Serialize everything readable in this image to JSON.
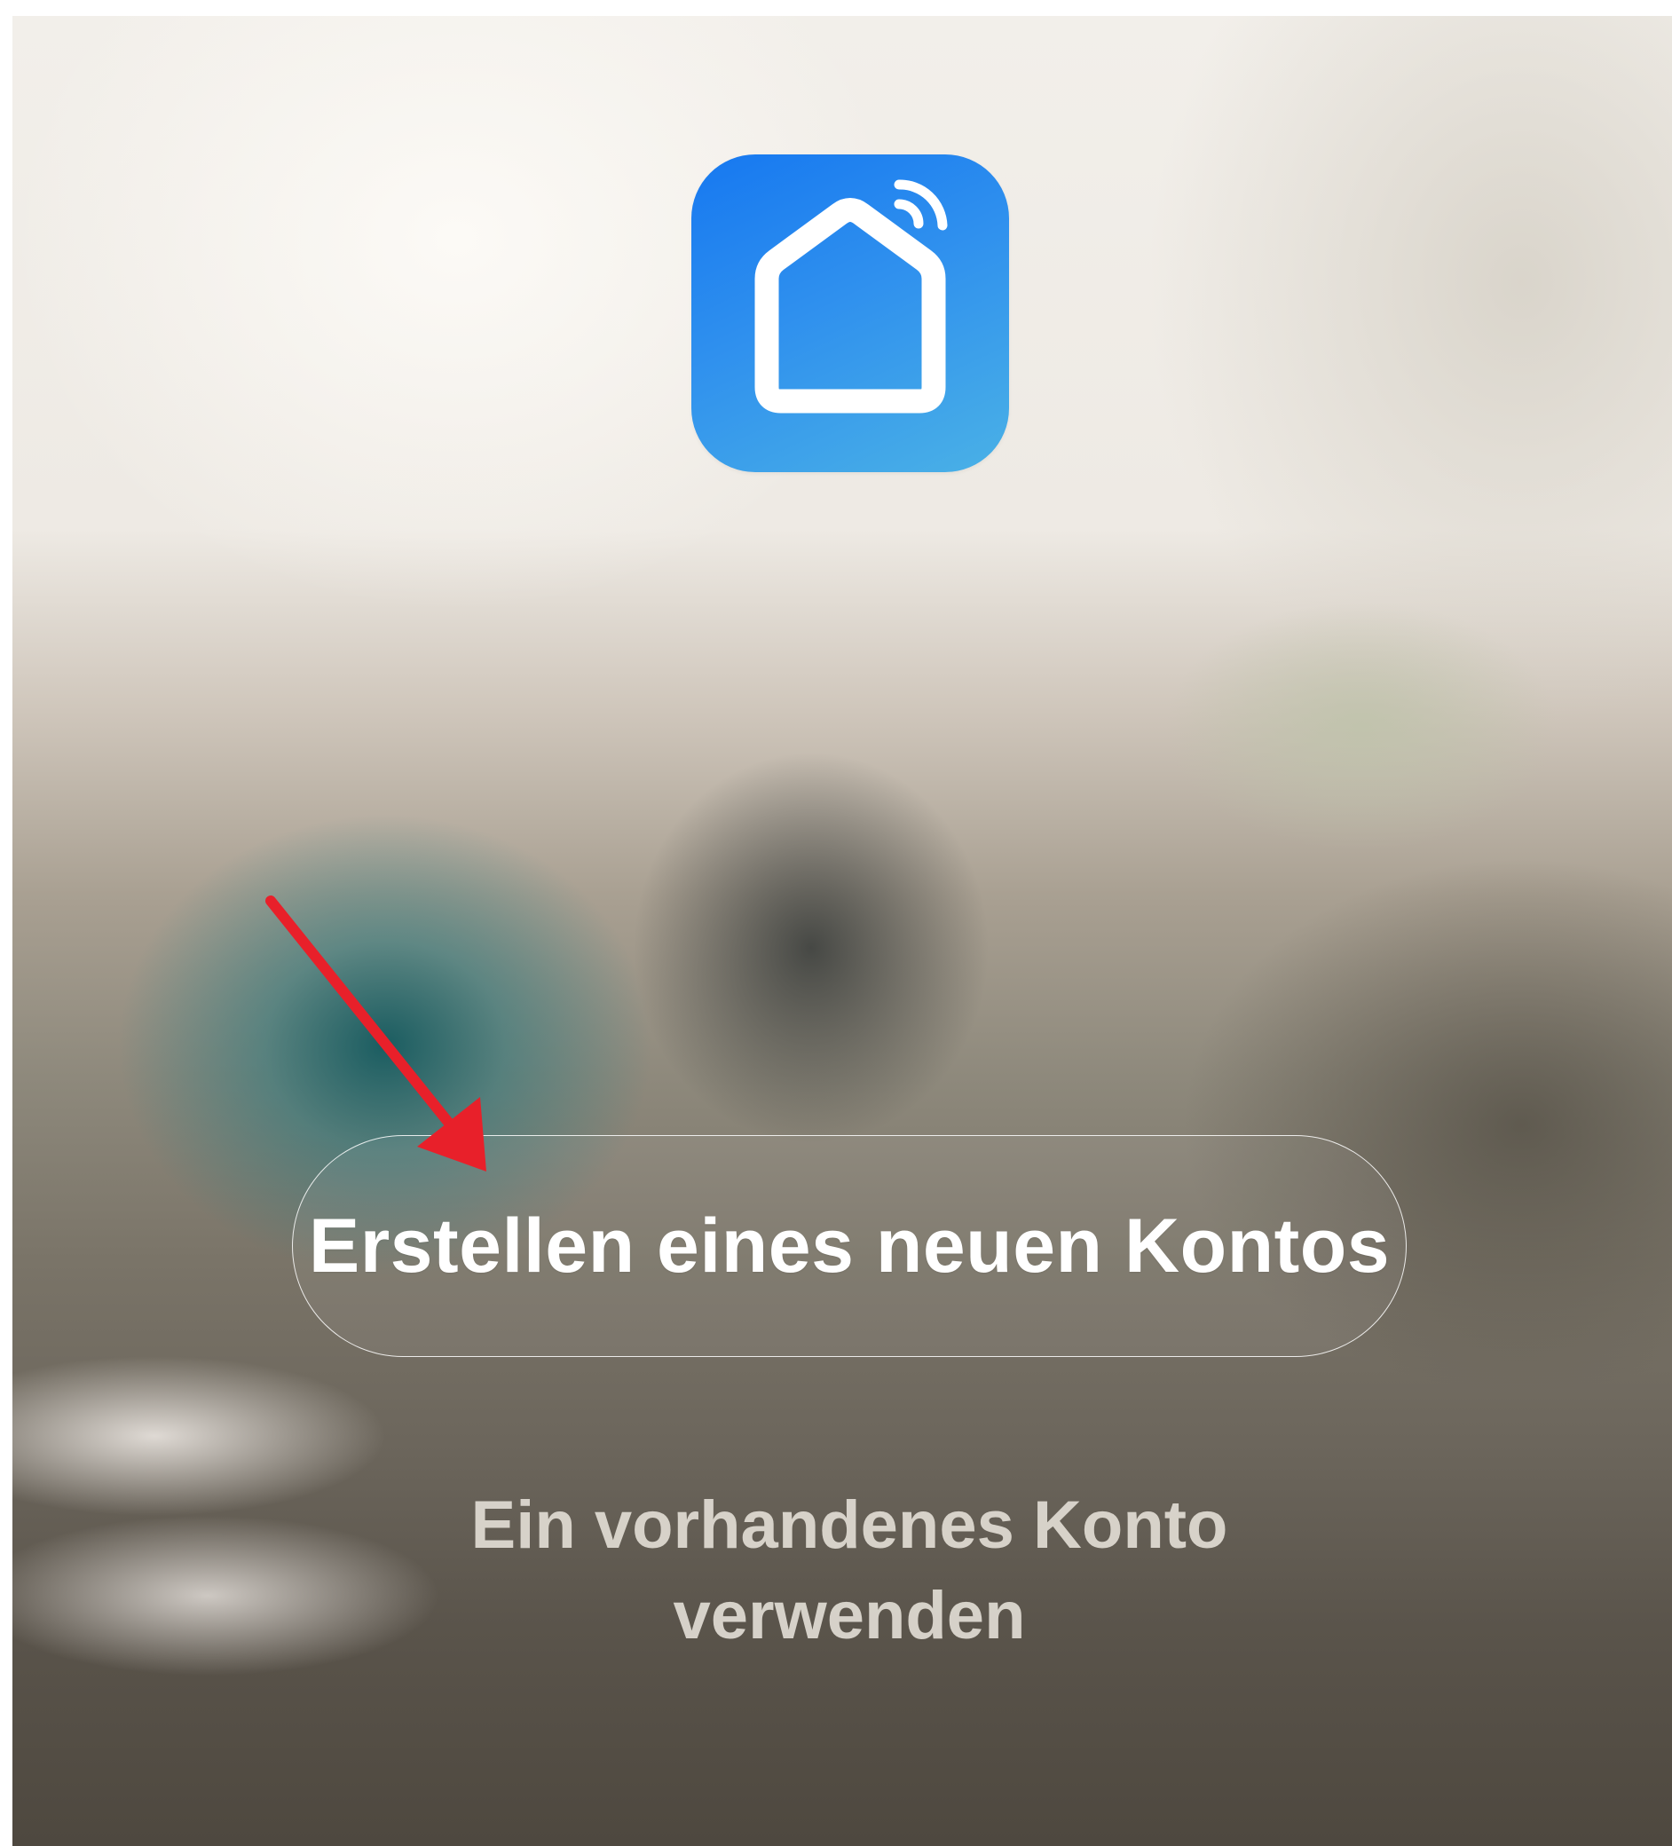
{
  "app": {
    "logo_icon": "smart-home-wifi-icon",
    "accent_color": "#1a7cf0"
  },
  "actions": {
    "create_account_label": "Erstellen eines neuen Kontos",
    "use_existing_line1": "Ein vorhandenes Konto",
    "use_existing_line2": "verwenden"
  },
  "annotation": {
    "arrow_icon": "arrow-pointer-icon",
    "arrow_color": "#e8202a"
  }
}
